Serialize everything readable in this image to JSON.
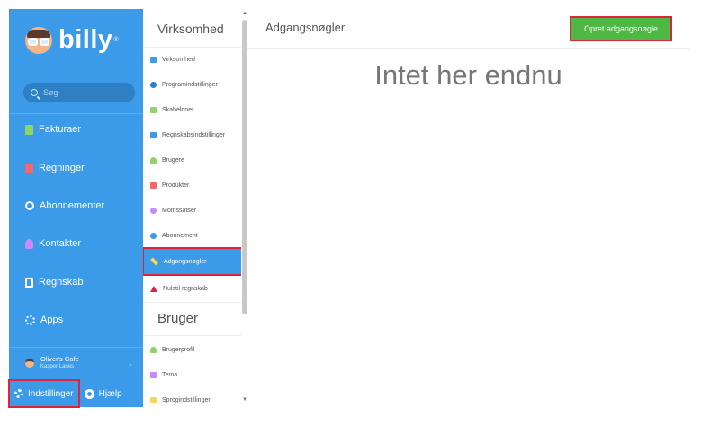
{
  "sidebar": {
    "brand": "billy",
    "brand_mark": "®",
    "search_placeholder": "Søg",
    "items": [
      {
        "label": "Fakturaer",
        "icon": "invoice-icon",
        "color": "#8fd466"
      },
      {
        "label": "Regninger",
        "icon": "bill-icon",
        "color": "#f06a6a"
      },
      {
        "label": "Abonnementer",
        "icon": "subscription-icon",
        "color": "#ffffff"
      },
      {
        "label": "Kontakter",
        "icon": "contacts-icon",
        "color": "#c58bff"
      },
      {
        "label": "Regnskab",
        "icon": "accounting-icon",
        "color": "#ffffff"
      },
      {
        "label": "Apps",
        "icon": "apps-icon",
        "color": "#ffffff"
      }
    ],
    "company_name": "Oliver's Cafe",
    "company_user": "Kasper Lanes",
    "settings_label": "Indstillinger",
    "help_label": "Hjælp"
  },
  "settings": {
    "company_section": "Virksomhed",
    "company_items": [
      {
        "label": "Virksomhed",
        "icon": "company-icon",
        "color": "#3c9be8"
      },
      {
        "label": "Programindstillinger",
        "icon": "gear-icon",
        "color": "#2e7fc4"
      },
      {
        "label": "Skabeloner",
        "icon": "templates-icon",
        "color": "#8fd466"
      },
      {
        "label": "Regnskabsindstillinger",
        "icon": "accounting-settings-icon",
        "color": "#3c9be8"
      },
      {
        "label": "Brugere",
        "icon": "users-icon",
        "color": "#8fd466"
      },
      {
        "label": "Produkter",
        "icon": "products-icon",
        "color": "#f06a6a"
      },
      {
        "label": "Momssatser",
        "icon": "vat-icon",
        "color": "#c58bff"
      },
      {
        "label": "Abonnement",
        "icon": "subscription-icon",
        "color": "#3c9be8"
      },
      {
        "label": "Adgangsnøgler",
        "icon": "key-icon",
        "color": "#f5d75a"
      },
      {
        "label": "Nulstil regnskab",
        "icon": "warning-icon",
        "color": "#e0223c"
      }
    ],
    "user_section": "Bruger",
    "user_items": [
      {
        "label": "Brugerprofil",
        "icon": "profile-icon",
        "color": "#8fd466"
      },
      {
        "label": "Tema",
        "icon": "theme-icon",
        "color": "#c58bff"
      },
      {
        "label": "Sprogindstillinger",
        "icon": "language-icon",
        "color": "#f5d75a"
      }
    ],
    "active_item": "Adgangsnøgler"
  },
  "main": {
    "title": "Adgangsnøgler",
    "create_button": "Opret adgangsnøgle",
    "empty_message": "Intet her endnu"
  },
  "colors": {
    "sidebar_bg": "#3c9be8",
    "button_green": "#4db843",
    "highlight_red": "#e0223c"
  }
}
